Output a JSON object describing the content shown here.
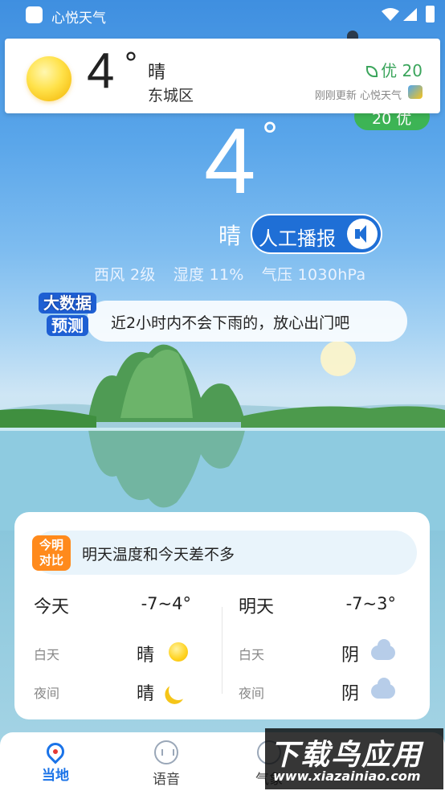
{
  "status_bar": {
    "app_name": "心悦天气"
  },
  "mini_card": {
    "temperature": "4",
    "degree": "°",
    "condition": "晴",
    "district": "东城区",
    "aqi_text": "优 20",
    "updated": "刚刚更新 心悦天气"
  },
  "aqi_pill": {
    "label": "20 优"
  },
  "hero": {
    "temperature": "4",
    "degree": "°",
    "condition": "晴",
    "broadcast_label": "人工播报",
    "wind": "西风 2级",
    "humidity": "湿度 11%",
    "pressure": "气压 1030hPa"
  },
  "forecast": {
    "badge_line1": "大数据",
    "badge_line2": "预测",
    "message": "近2小时内不会下雨的，放心出门吧"
  },
  "compare": {
    "badge_line1": "今明",
    "badge_line2": "对比",
    "message": "明天温度和今天差不多",
    "today": {
      "label": "今天",
      "range": "-7~4°",
      "day_label": "白天",
      "day_cond": "晴",
      "day_icon": "sun-icon",
      "night_label": "夜间",
      "night_cond": "晴",
      "night_icon": "moon-icon"
    },
    "tomorrow": {
      "label": "明天",
      "range": "-7~3°",
      "day_label": "白天",
      "day_cond": "阴",
      "day_icon": "cloud-icon",
      "night_label": "夜间",
      "night_cond": "阴",
      "night_icon": "cloud-icon"
    }
  },
  "nav": {
    "items": [
      {
        "label": "当地",
        "icon": "location-pin-icon",
        "active": true
      },
      {
        "label": "语音",
        "icon": "voice-icon",
        "active": false
      },
      {
        "label": "气象",
        "icon": "weather-icon",
        "active": false
      }
    ]
  },
  "watermark": {
    "title": "下载鸟应用",
    "url": "www.xiazainiao.com"
  },
  "colors": {
    "accent": "#1a73e8",
    "aqi_green": "#3db455",
    "broadcast_blue": "#1f6fd6",
    "badge_orange": "#ff8a1c"
  }
}
